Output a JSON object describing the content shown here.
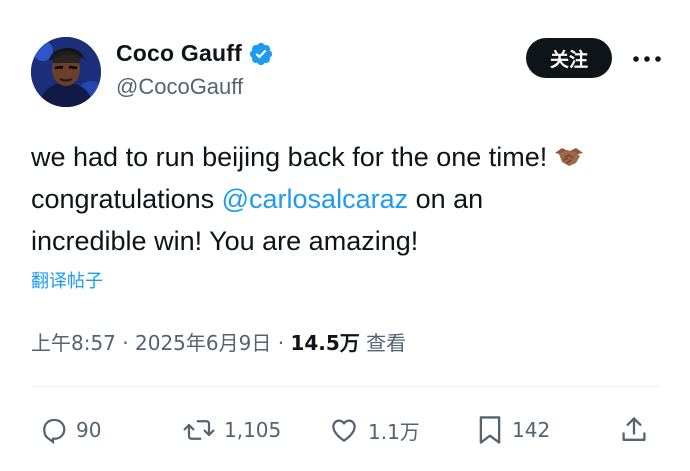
{
  "author": {
    "display_name": "Coco Gauff",
    "handle": "@CocoGauff",
    "verified_icon": "verified-badge-icon"
  },
  "header": {
    "follow_label": "关注",
    "more_icon": "more-icon"
  },
  "tweet": {
    "line1": "we had to run beijing back for the one time!",
    "line2_prefix": "congratulations ",
    "mention": "@carlosalcaraz",
    "line2_suffix": " on an",
    "line3": "incredible win! You are amazing!",
    "emoji": "handshake-emoji"
  },
  "translate_label": "翻译帖子",
  "meta": {
    "time": "上午8:57",
    "separator": " · ",
    "date": "2025年6月9日",
    "views_count": "14.5万",
    "views_label": " 查看"
  },
  "actions": {
    "replies": "90",
    "reposts": "1,105",
    "likes": "1.1万",
    "bookmarks": "142"
  },
  "colors": {
    "accent": "#1d9bf0",
    "text": "#0f1419",
    "secondary": "#536471"
  }
}
